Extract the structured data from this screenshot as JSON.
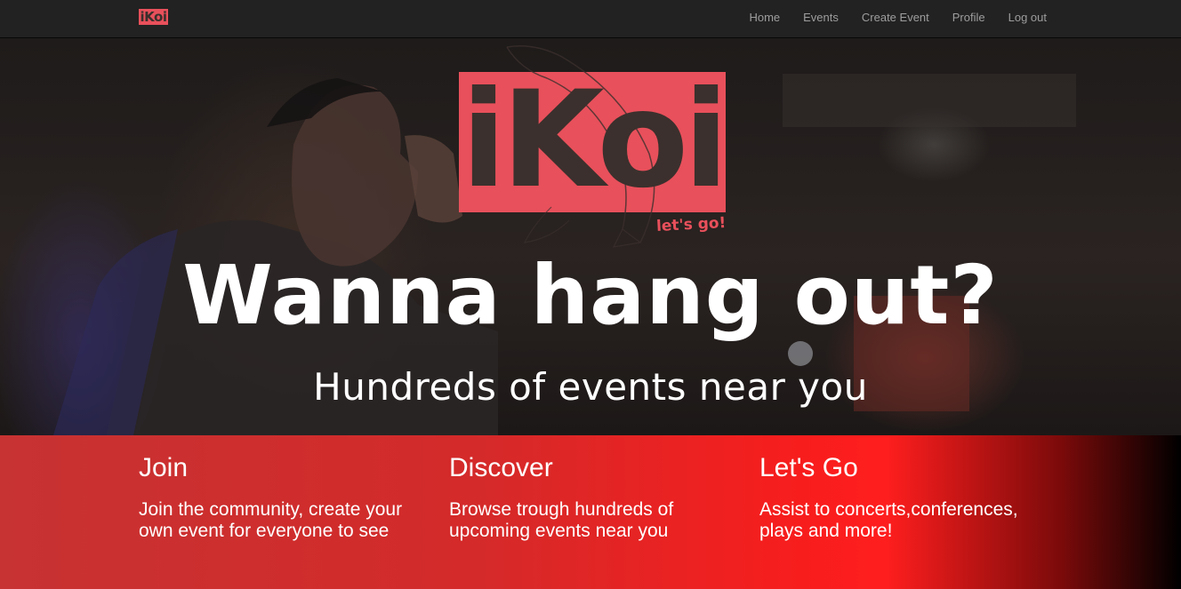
{
  "nav": {
    "brand": "iKoi",
    "links": [
      "Home",
      "Events",
      "Create Event",
      "Profile",
      "Log out"
    ]
  },
  "hero": {
    "logo_text": "iKoi",
    "logo_tagline": "let's go!",
    "title": "Wanna hang out?",
    "subtitle": "Hundreds of events near you"
  },
  "features": [
    {
      "title": "Join",
      "text": "Join the community, create your own event for everyone to see"
    },
    {
      "title": "Discover",
      "text": "Browse trough hundreds of upcoming events near you"
    },
    {
      "title": "Let's Go",
      "text": "Assist to concerts,conferences, plays and more!"
    }
  ],
  "colors": {
    "brand": "#e8505b",
    "navbar": "#222222",
    "band_red": "#ff1e1e"
  }
}
